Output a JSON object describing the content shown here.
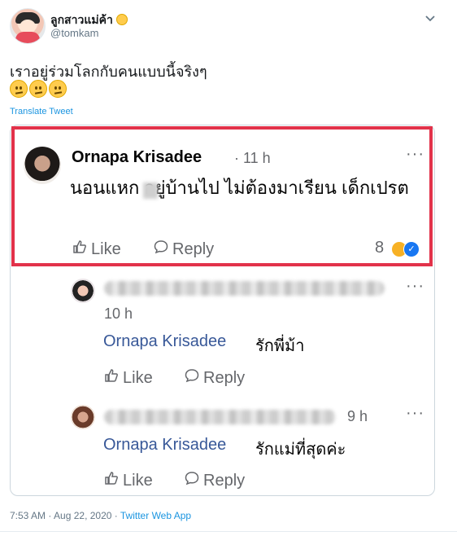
{
  "tweet": {
    "author_name": "ลูกสาวแม่ค้า",
    "author_handle": "@tomkam",
    "text": "เราอยู่ร่วมโลกกับคนแบบนี้จริงๆ",
    "emoji_icons": [
      "confused-face-icon",
      "confused-face-icon",
      "confused-face-icon"
    ],
    "translate_label": "Translate Tweet",
    "timestamp": "7:53 AM · Aug 22, 2020",
    "separator": " · ",
    "source": "Twitter Web App"
  },
  "comments": [
    {
      "name": "Ornapa Krisadee",
      "time": "· 11 h",
      "text": "นอนแหก  อยู่บ้านไป ไม่ต้องมาเรียน เด็กเปรต",
      "like_label": "Like",
      "reply_label": "Reply",
      "reaction_count": "8"
    },
    {
      "time": "10 h",
      "tag": "Ornapa Krisadee",
      "text": "รักพี่ม้า",
      "like_label": "Like",
      "reply_label": "Reply"
    },
    {
      "time": "9 h",
      "tag": "Ornapa Krisadee",
      "text": "รักแม่ที่สุดค่ะ",
      "like_label": "Like",
      "reply_label": "Reply"
    }
  ],
  "more_label": "···",
  "colors": {
    "highlight": "#e2324a",
    "twitter_blue": "#1b95e0",
    "fb_link": "#385898"
  }
}
